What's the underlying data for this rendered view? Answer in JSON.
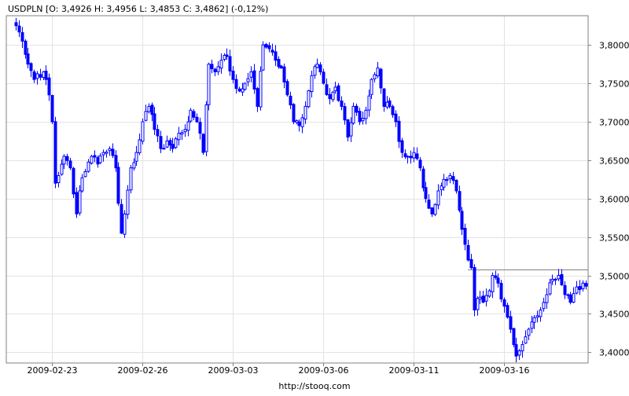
{
  "chart_data": {
    "type": "candlestick",
    "title": "USDPLN [O: 3,4926  H: 3,4956  L: 3,4853  C: 3,4862] (-0,12%)",
    "footer": "http://stooq.com",
    "xlabel": "",
    "ylabel": "",
    "ylim": [
      3.386,
      3.838
    ],
    "y_ticks": [
      3.8,
      3.75,
      3.7,
      3.65,
      3.6,
      3.55,
      3.5,
      3.45,
      3.4
    ],
    "y_tick_labels": [
      "3,8000",
      "3,7500",
      "3,7000",
      "3,6500",
      "3,6000",
      "3,5500",
      "3,5000",
      "3,4500",
      "3,4000"
    ],
    "x_tick_labels": [
      "2009-02-23",
      "2009-02-26",
      "2009-03-03",
      "2009-03-06",
      "2009-03-11",
      "2009-03-16"
    ],
    "x_tick_index": [
      12,
      42,
      72,
      102,
      132,
      162
    ],
    "grid": true,
    "reference_level": 3.508,
    "reference_from_index": 150,
    "candle_color": "#0000ff",
    "close_anchors": [
      [
        0,
        3.825
      ],
      [
        2,
        3.805
      ],
      [
        4,
        3.775
      ],
      [
        6,
        3.755
      ],
      [
        8,
        3.758
      ],
      [
        9,
        3.765
      ],
      [
        10,
        3.755
      ],
      [
        11,
        3.735
      ],
      [
        12,
        3.7
      ],
      [
        13,
        3.62
      ],
      [
        14,
        3.63
      ],
      [
        16,
        3.655
      ],
      [
        18,
        3.64
      ],
      [
        20,
        3.58
      ],
      [
        21,
        3.61
      ],
      [
        23,
        3.635
      ],
      [
        25,
        3.655
      ],
      [
        27,
        3.645
      ],
      [
        29,
        3.66
      ],
      [
        31,
        3.665
      ],
      [
        33,
        3.64
      ],
      [
        35,
        3.555
      ],
      [
        36,
        3.58
      ],
      [
        38,
        3.64
      ],
      [
        40,
        3.66
      ],
      [
        42,
        3.7
      ],
      [
        44,
        3.72
      ],
      [
        46,
        3.69
      ],
      [
        48,
        3.665
      ],
      [
        50,
        3.675
      ],
      [
        52,
        3.665
      ],
      [
        54,
        3.685
      ],
      [
        56,
        3.69
      ],
      [
        58,
        3.715
      ],
      [
        60,
        3.7
      ],
      [
        62,
        3.66
      ],
      [
        64,
        3.775
      ],
      [
        66,
        3.765
      ],
      [
        68,
        3.78
      ],
      [
        70,
        3.785
      ],
      [
        72,
        3.755
      ],
      [
        74,
        3.74
      ],
      [
        76,
        3.75
      ],
      [
        78,
        3.765
      ],
      [
        80,
        3.72
      ],
      [
        82,
        3.8
      ],
      [
        84,
        3.795
      ],
      [
        86,
        3.78
      ],
      [
        88,
        3.77
      ],
      [
        90,
        3.735
      ],
      [
        92,
        3.7
      ],
      [
        94,
        3.695
      ],
      [
        96,
        3.72
      ],
      [
        98,
        3.76
      ],
      [
        100,
        3.775
      ],
      [
        102,
        3.75
      ],
      [
        104,
        3.73
      ],
      [
        106,
        3.745
      ],
      [
        108,
        3.72
      ],
      [
        110,
        3.68
      ],
      [
        112,
        3.72
      ],
      [
        114,
        3.7
      ],
      [
        116,
        3.715
      ],
      [
        118,
        3.755
      ],
      [
        120,
        3.77
      ],
      [
        122,
        3.72
      ],
      [
        124,
        3.72
      ],
      [
        126,
        3.7
      ],
      [
        128,
        3.66
      ],
      [
        130,
        3.655
      ],
      [
        132,
        3.66
      ],
      [
        134,
        3.64
      ],
      [
        136,
        3.6
      ],
      [
        138,
        3.58
      ],
      [
        140,
        3.61
      ],
      [
        142,
        3.625
      ],
      [
        144,
        3.63
      ],
      [
        146,
        3.61
      ],
      [
        148,
        3.56
      ],
      [
        150,
        3.52
      ],
      [
        151,
        3.51
      ],
      [
        152,
        3.455
      ],
      [
        153,
        3.47
      ],
      [
        155,
        3.465
      ],
      [
        157,
        3.48
      ],
      [
        158,
        3.5
      ],
      [
        160,
        3.49
      ],
      [
        162,
        3.46
      ],
      [
        164,
        3.43
      ],
      [
        165,
        3.41
      ],
      [
        166,
        3.395
      ],
      [
        168,
        3.41
      ],
      [
        170,
        3.43
      ],
      [
        172,
        3.445
      ],
      [
        174,
        3.455
      ],
      [
        176,
        3.475
      ],
      [
        178,
        3.495
      ],
      [
        180,
        3.5
      ],
      [
        182,
        3.475
      ],
      [
        184,
        3.465
      ],
      [
        186,
        3.485
      ],
      [
        188,
        3.49
      ],
      [
        189,
        3.486
      ]
    ]
  }
}
